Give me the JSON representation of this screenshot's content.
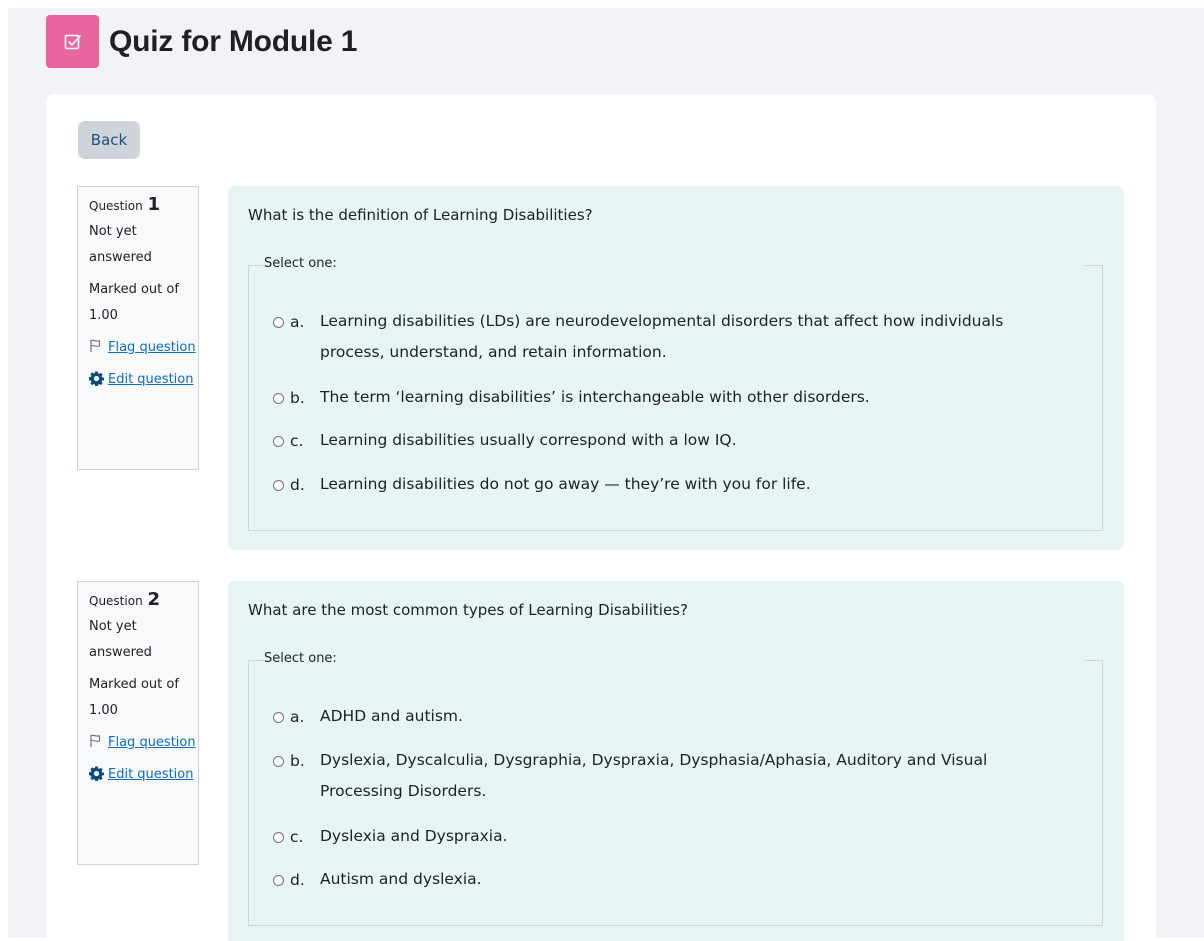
{
  "page": {
    "title": "Quiz for Module 1",
    "icon": "quiz-checkbox-icon",
    "accent_color": "#e8659e"
  },
  "nav": {
    "back_label": "Back"
  },
  "questions": [
    {
      "prefix": "Question",
      "number": "1",
      "state": "Not yet answered",
      "grade": "Marked out of 1.00",
      "flag_label": "Flag question",
      "edit_label": "Edit question",
      "text": "What is the definition of Learning Disabilities?",
      "prompt": "Select one:",
      "options": [
        {
          "letter": "a.",
          "text": "Learning disabilities (LDs) are neurodevelopmental disorders that affect how individuals process, understand, and retain information."
        },
        {
          "letter": "b.",
          "text": "The term ‘learning disabilities’ is interchangeable with other disorders."
        },
        {
          "letter": "c.",
          "text": "Learning disabilities usually correspond with a low IQ."
        },
        {
          "letter": "d.",
          "text": "Learning disabilities do not go away — they’re with you for life."
        }
      ]
    },
    {
      "prefix": "Question",
      "number": "2",
      "state": "Not yet answered",
      "grade": "Marked out of 1.00",
      "flag_label": "Flag question",
      "edit_label": "Edit question",
      "text": "What are the most common types of Learning Disabilities?",
      "prompt": "Select one:",
      "options": [
        {
          "letter": "a.",
          "text": "ADHD and autism."
        },
        {
          "letter": "b.",
          "text": "Dyslexia, Dyscalculia, Dysgraphia, Dyspraxia, Dysphasia/Aphasia, Auditory and Visual Processing Disorders."
        },
        {
          "letter": "c.",
          "text": "Dyslexia and Dyspraxia."
        },
        {
          "letter": "d.",
          "text": "Autism and dyslexia."
        }
      ]
    }
  ]
}
